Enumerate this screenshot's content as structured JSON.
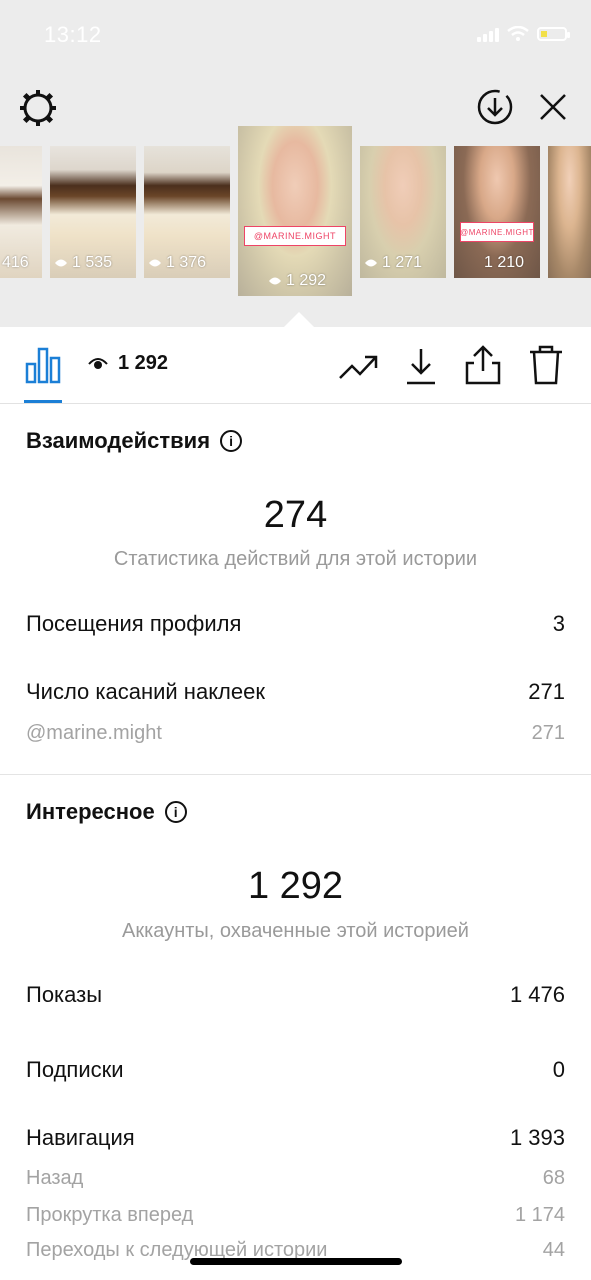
{
  "status_bar": {
    "time": "13:12"
  },
  "thumbnails": [
    {
      "views": "416"
    },
    {
      "views": "1 535"
    },
    {
      "views": "1 376"
    },
    {
      "views": "1 292",
      "tag": "@MARINE.MIGHT",
      "selected": true
    },
    {
      "views": "1 271"
    },
    {
      "views": "1 210",
      "tag": "@MARINE.MIGHT"
    },
    {
      "views": ""
    }
  ],
  "toolbar": {
    "views_count": "1 292"
  },
  "interactions": {
    "title": "Взаимодействия",
    "total": "274",
    "total_caption": "Статистика действий для этой истории",
    "rows": [
      {
        "label": "Посещения профиля",
        "value": "3"
      },
      {
        "label": "Число касаний наклеек",
        "value": "271"
      }
    ],
    "sub_rows": [
      {
        "label": "@marine.might",
        "value": "271"
      }
    ]
  },
  "discovery": {
    "title": "Интересное",
    "total": "1 292",
    "total_caption": "Аккаунты, охваченные этой историей",
    "rows": [
      {
        "label": "Показы",
        "value": "1 476"
      },
      {
        "label": "Подписки",
        "value": "0"
      },
      {
        "label": "Навигация",
        "value": "1 393"
      }
    ],
    "sub_rows": [
      {
        "label": "Назад",
        "value": "68"
      },
      {
        "label": "Прокрутка вперед",
        "value": "1 174"
      },
      {
        "label": "Переходы к следующей истории",
        "value": "44"
      }
    ]
  }
}
